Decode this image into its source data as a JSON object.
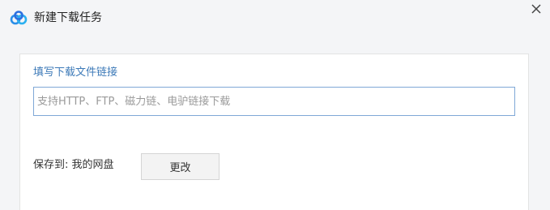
{
  "dialog": {
    "title": "新建下载任务",
    "logo_icon": "baidu-netdisk-logo",
    "close_icon": "close-icon"
  },
  "form": {
    "url_label": "填写下载文件链接",
    "url_placeholder": "支持HTTP、FTP、磁力链、电驴链接下载",
    "url_value": "",
    "save_to_label": "保存到: 我的网盘",
    "change_button_label": "更改"
  },
  "colors": {
    "accent_blue": "#3d7ab8",
    "input_border": "#7fa8d6",
    "background": "#f4f5f7"
  }
}
